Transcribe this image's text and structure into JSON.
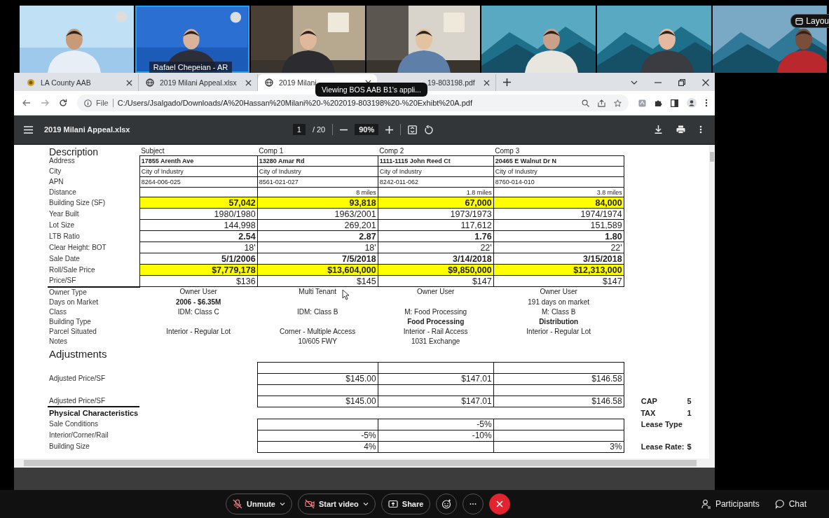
{
  "video_strip": {
    "tiles": [
      {
        "kind": "picture",
        "active_speaker": false
      },
      {
        "kind": "picture",
        "active_speaker": true,
        "name_label": "Rafael Chepeian - AR"
      },
      {
        "kind": "picture",
        "active_speaker": false
      },
      {
        "kind": "picture",
        "active_speaker": false
      },
      {
        "kind": "picture",
        "active_speaker": false
      },
      {
        "kind": "picture",
        "active_speaker": false
      },
      {
        "kind": "picture",
        "active_speaker": false
      }
    ],
    "layout_button": "Layou"
  },
  "browser": {
    "tabs": [
      {
        "title": "LA County AAB",
        "kind": "seal",
        "selected": false
      },
      {
        "title": "2019 Milani Appeal.xlsx",
        "kind": "globe",
        "selected": false
      },
      {
        "title": "2019 Milani",
        "kind": "globe",
        "selected": true
      },
      {
        "title": "19-803198.pdf",
        "selected": false
      }
    ],
    "tooltip": "Viewing BOS AAB B1's appli...",
    "address": {
      "scheme": "File",
      "url": "C:/Users/Jsalgado/Downloads/A%20Hassan%20Milani%20-%202019-803198%20-%20Exhibt%20A.pdf"
    }
  },
  "pdf_viewer": {
    "title": "2019 Milani Appeal.xlsx",
    "page": "1",
    "page_count": "/ 20",
    "zoom": "90%"
  },
  "sheet": {
    "rows": [
      {
        "kind": "header",
        "label": "Description",
        "cells": [
          "Subject",
          "Comp 1",
          "Comp 2",
          "Comp 3"
        ]
      },
      {
        "kind": "address",
        "label": "Address",
        "cells": [
          "17855 Arenth Ave",
          "13280 Amar Rd",
          "1111-1115 John Reed Ct",
          "20465 E Walnut Dr N"
        ]
      },
      {
        "kind": "info",
        "label": "City",
        "cells": [
          "City of Industry",
          "City of Industry",
          "City of Industry",
          "City of Industry"
        ]
      },
      {
        "kind": "info",
        "label": "APN",
        "cells": [
          "8264-006-025",
          "8561-021-027",
          "8242-011-062",
          "8760-014-010"
        ]
      },
      {
        "kind": "small_value",
        "label": "Distance",
        "cells": [
          null,
          "8 miles",
          "1.8 miles",
          "3.8 miles"
        ]
      },
      {
        "kind": "highlight",
        "label": "Building Size (SF)",
        "cells": [
          "57,042",
          "93,818",
          "67,000",
          "84,000"
        ]
      },
      {
        "kind": "value",
        "label": "Year Built",
        "cells": [
          "1980/1980",
          "1963/2001",
          "1973/1973",
          "1974/1974"
        ]
      },
      {
        "kind": "value",
        "label": "Lot Size",
        "cells": [
          "144,998",
          "269,201",
          "117,612",
          "151,589"
        ]
      },
      {
        "kind": "bold_value",
        "label": "LTB Ratio",
        "cells": [
          "2.54",
          "2.87",
          "1.76",
          "1.80"
        ]
      },
      {
        "kind": "value",
        "label": "Clear Height: BOT",
        "cells": [
          "18'",
          "18'",
          "22'",
          "22'"
        ]
      },
      {
        "kind": "bold_value",
        "label": "Sale Date",
        "cells": [
          "5/1/2006",
          "7/5/2018",
          "3/14/2018",
          "3/15/2018"
        ]
      },
      {
        "kind": "highlight",
        "label": "Roll/Sale Price",
        "cells": [
          "$7,779,178",
          "$13,604,000",
          "$9,850,000",
          "$12,313,000"
        ]
      },
      {
        "kind": "value",
        "label": "Price/SF",
        "cells": [
          "$136",
          "$145",
          "$147",
          "$147"
        ],
        "rule": true
      },
      {
        "kind": "note",
        "label": "Owner Type",
        "cells": [
          "Owner User",
          "Multi Tenant",
          "Owner User",
          "Owner User"
        ]
      },
      {
        "kind": "note",
        "label": "Days on Market",
        "cells": [
          {
            "text": "2006 - $6.35M",
            "bold": true
          },
          null,
          null,
          "191 days on market"
        ]
      },
      {
        "kind": "note",
        "label": "Class",
        "cells": [
          "IDM: Class C",
          "IDM: Class B",
          "M: Food Processing",
          "M: Class B"
        ]
      },
      {
        "kind": "note",
        "label": "Building Type",
        "cells": [
          null,
          null,
          {
            "text": "Food Processing",
            "bold": true
          },
          {
            "text": "Distribution",
            "bold": true
          }
        ]
      },
      {
        "kind": "note",
        "label": "Parcel Situated",
        "cells": [
          "Interior - Regular Lot",
          "Corner - Multiple Access",
          "Interior - Rail Access",
          "Interior - Regular Lot"
        ]
      },
      {
        "kind": "note",
        "label": "Notes",
        "cells": [
          null,
          "10/605 FWY",
          "1031 Exchange",
          null
        ]
      },
      {
        "kind": "section",
        "label": "Adjustments"
      },
      {
        "kind": "adjust"
      },
      {
        "kind": "adjust",
        "label": "Adjusted Price/SF",
        "cells": [
          null,
          "$145.00",
          "$147.01",
          "$146.58"
        ]
      },
      {
        "kind": "adjust"
      },
      {
        "kind": "adjust",
        "label": "Adjusted Price/SF",
        "cells": [
          null,
          "$145.00",
          "$147.01",
          "$146.58"
        ],
        "rule": true,
        "side": {
          "label": "CAP",
          "value": "5"
        }
      },
      {
        "kind": "subheading",
        "label": "Physical Characteristics",
        "side": {
          "label": "TAX",
          "value": "1"
        }
      },
      {
        "kind": "adjust",
        "label": "Sale Conditions",
        "cells": [
          null,
          null,
          "-5%",
          null
        ],
        "side": {
          "label": "Lease Type"
        }
      },
      {
        "kind": "adjust",
        "label": "Interior/Corner/Rail",
        "cells": [
          null,
          "-5%",
          "-10%",
          null
        ]
      },
      {
        "kind": "adjust",
        "label": "Building Size",
        "cells": [
          null,
          "4%",
          null,
          "3%"
        ],
        "side": {
          "label": "Lease Rate:",
          "value": "$"
        }
      }
    ]
  },
  "meeting_controls": {
    "buttons": [
      {
        "kind": "mute",
        "label": "Unmute",
        "caret": true
      },
      {
        "kind": "video",
        "label": "Start video",
        "caret": true
      },
      {
        "kind": "share",
        "label": "Share",
        "caret": false
      },
      {
        "kind": "reactions"
      },
      {
        "kind": "more"
      },
      {
        "kind": "leave"
      }
    ],
    "panels": [
      {
        "kind": "participants",
        "label": "Participants"
      },
      {
        "kind": "chat",
        "label": "Chat"
      }
    ]
  }
}
